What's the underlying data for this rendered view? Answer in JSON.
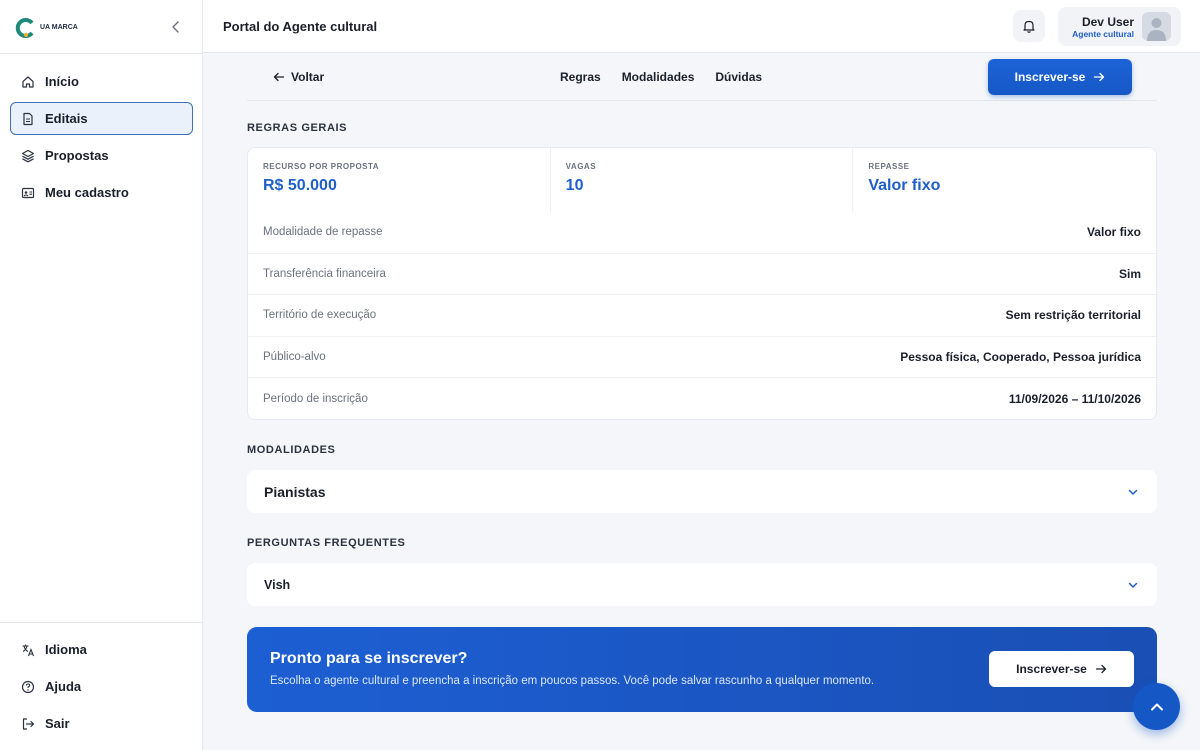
{
  "brand": {
    "name": "UA MARCA",
    "logo_icon": "brand-logo"
  },
  "sidebar": {
    "collapse_icon": "chevron-left-icon",
    "items": [
      {
        "label": "Início",
        "icon": "home-icon"
      },
      {
        "label": "Editais",
        "icon": "document-icon",
        "active": true
      },
      {
        "label": "Propostas",
        "icon": "layers-icon"
      },
      {
        "label": "Meu cadastro",
        "icon": "id-card-icon"
      }
    ],
    "footer_items": [
      {
        "label": "Idioma",
        "icon": "translate-icon"
      },
      {
        "label": "Ajuda",
        "icon": "help-circle-icon"
      },
      {
        "label": "Sair",
        "icon": "logout-icon"
      }
    ]
  },
  "header": {
    "title": "Portal do Agente cultural",
    "notification_icon": "bell-icon",
    "user": {
      "name": "Dev User",
      "role": "Agente cultural"
    }
  },
  "subnav": {
    "back_label": "Voltar",
    "tabs": [
      "Regras",
      "Modalidades",
      "Dúvidas"
    ],
    "subscribe_label": "Inscrever-se"
  },
  "rules": {
    "section_title": "REGRAS GERAIS",
    "stats": [
      {
        "label": "RECURSO POR PROPOSTA",
        "value": "R$ 50.000"
      },
      {
        "label": "VAGAS",
        "value": "10"
      },
      {
        "label": "REPASSE",
        "value": "Valor fixo"
      }
    ],
    "rows": [
      {
        "label": "Modalidade de repasse",
        "value": "Valor fixo"
      },
      {
        "label": "Transferência financeira",
        "value": "Sim"
      },
      {
        "label": "Território de execução",
        "value": "Sem restrição territorial"
      },
      {
        "label": "Público-alvo",
        "value": "Pessoa física, Cooperado, Pessoa jurídica"
      },
      {
        "label": "Período de inscrição",
        "value": "11/09/2026 – 11/10/2026"
      }
    ]
  },
  "modalidades": {
    "section_title": "MODALIDADES",
    "items": [
      "Pianistas"
    ]
  },
  "faq": {
    "section_title": "PERGUNTAS FREQUENTES",
    "items": [
      "Vish"
    ]
  },
  "cta": {
    "title": "Pronto para se inscrever?",
    "text": "Escolha o agente cultural e preencha a inscrição em poucos passos. Você pode salvar rascunho a qualquer momento.",
    "button_label": "Inscrever-se"
  },
  "colors": {
    "accent": "#1f5fc9",
    "primary_button": "#1557c5"
  }
}
